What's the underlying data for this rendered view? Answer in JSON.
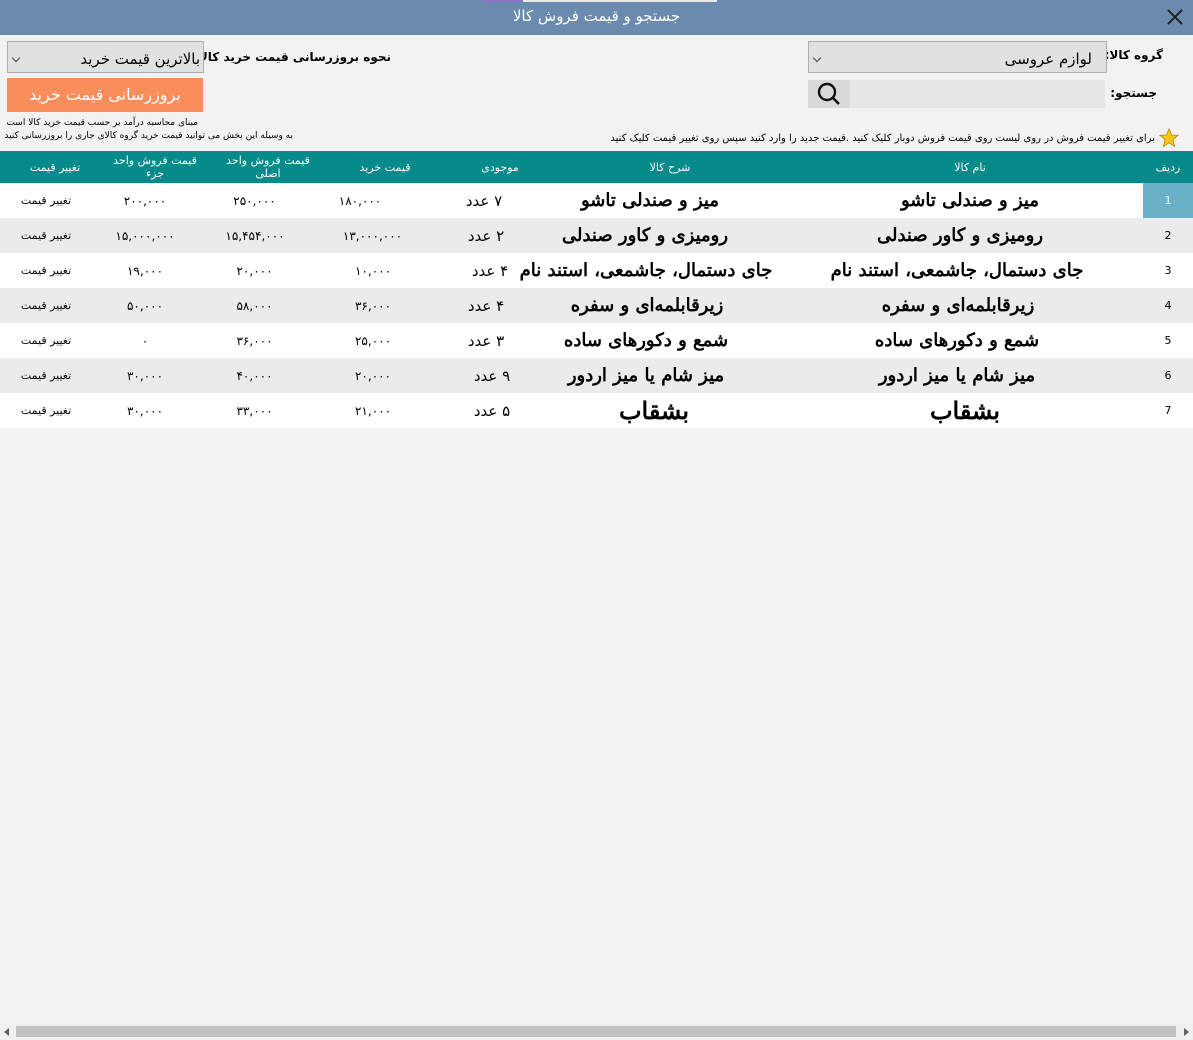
{
  "window": {
    "title": "جستجو و قیمت فروش کالا"
  },
  "filters": {
    "group_label": "گروه کالا:",
    "group_value": "لوازم عروسی",
    "search_label": "جستجو:",
    "search_value": "",
    "update_method_label": "نحوه بروزرسانی قیمت خرید کالا :",
    "update_method_value": "بالاترین قیمت خرید",
    "update_button": "بروزرسانی قیمت خرید",
    "calc_note_1": "مبنای محاسبه درآمد بر حسب قیمت خرید کالا است",
    "calc_note_2": "به وسیله این بخش می توانید قیمت خرید گروه کالای جاری را بروزرسانی کنید",
    "hint": "برای تغییر قیمت فروش در روی لیست روی قیمت فروش دوبار کلیک کنید .قیمت جدید را وارد کنید سپس روی تغییر قیمت کلیک کنید"
  },
  "grid": {
    "headers": {
      "index": "ردیف",
      "name": "نام کالا",
      "desc": "شرح کالا",
      "stock": "موجودی",
      "buy": "قیمت خرید",
      "sell_main": "قیمت فروش واحد اصلی",
      "sell_part": "قیمت فروش واحد جزء",
      "change": "تغییر قیمت"
    },
    "rows": [
      {
        "index": "1",
        "name": "میز و صندلی تاشو",
        "desc": "میز و صندلی تاشو",
        "stock": "۷ عدد",
        "buy": "۱۸۰,۰۰۰",
        "sell_main": "۲۵۰,۰۰۰",
        "sell_part": "۲۰۰,۰۰۰",
        "change": "تغییر قیمت"
      },
      {
        "index": "2",
        "name": "رومیزی و کاور صندلی",
        "desc": "رومیزی و کاور صندلی",
        "stock": "۲ عدد",
        "buy": "۱۳,۰۰۰,۰۰۰",
        "sell_main": "۱۵,۴۵۴,۰۰۰",
        "sell_part": "۱۵,۰۰۰,۰۰۰",
        "change": "تغییر قیمت"
      },
      {
        "index": "3",
        "name": "جای دستمال، جاشمعی، استند نام",
        "desc": "جای دستمال، جاشمعی، استند نام",
        "stock": "۴ عدد",
        "buy": "۱۰,۰۰۰",
        "sell_main": "۲۰,۰۰۰",
        "sell_part": "۱۹,۰۰۰",
        "change": "تغییر قیمت"
      },
      {
        "index": "4",
        "name": "زیرقابلمه‌ای و سفره",
        "desc": "زیرقابلمه‌ای و سفره",
        "stock": "۴ عدد",
        "buy": "۳۶,۰۰۰",
        "sell_main": "۵۸,۰۰۰",
        "sell_part": "۵۰,۰۰۰",
        "change": "تغییر قیمت"
      },
      {
        "index": "5",
        "name": "شمع و دکورهای ساده",
        "desc": "شمع و دکورهای ساده",
        "stock": "۳ عدد",
        "buy": "۲۵,۰۰۰",
        "sell_main": "۳۶,۰۰۰",
        "sell_part": "۰",
        "change": "تغییر قیمت"
      },
      {
        "index": "6",
        "name": "میز شام یا میز اردور",
        "desc": "میز شام یا میز اردور",
        "stock": "۹ عدد",
        "buy": "۲۰,۰۰۰",
        "sell_main": "۴۰,۰۰۰",
        "sell_part": "۳۰,۰۰۰",
        "change": "تغییر قیمت"
      },
      {
        "index": "7",
        "name": "بشقاب",
        "desc": "بشقاب",
        "stock": "۵ عدد",
        "buy": "۲۱,۰۰۰",
        "sell_main": "۳۳,۰۰۰",
        "sell_part": "۳۰,۰۰۰",
        "change": "تغییر قیمت"
      }
    ]
  },
  "colors": {
    "titlebar": "#6a8bad",
    "header": "#068a8a",
    "button": "#f98d5b",
    "selected_row": "#6aafc8"
  }
}
